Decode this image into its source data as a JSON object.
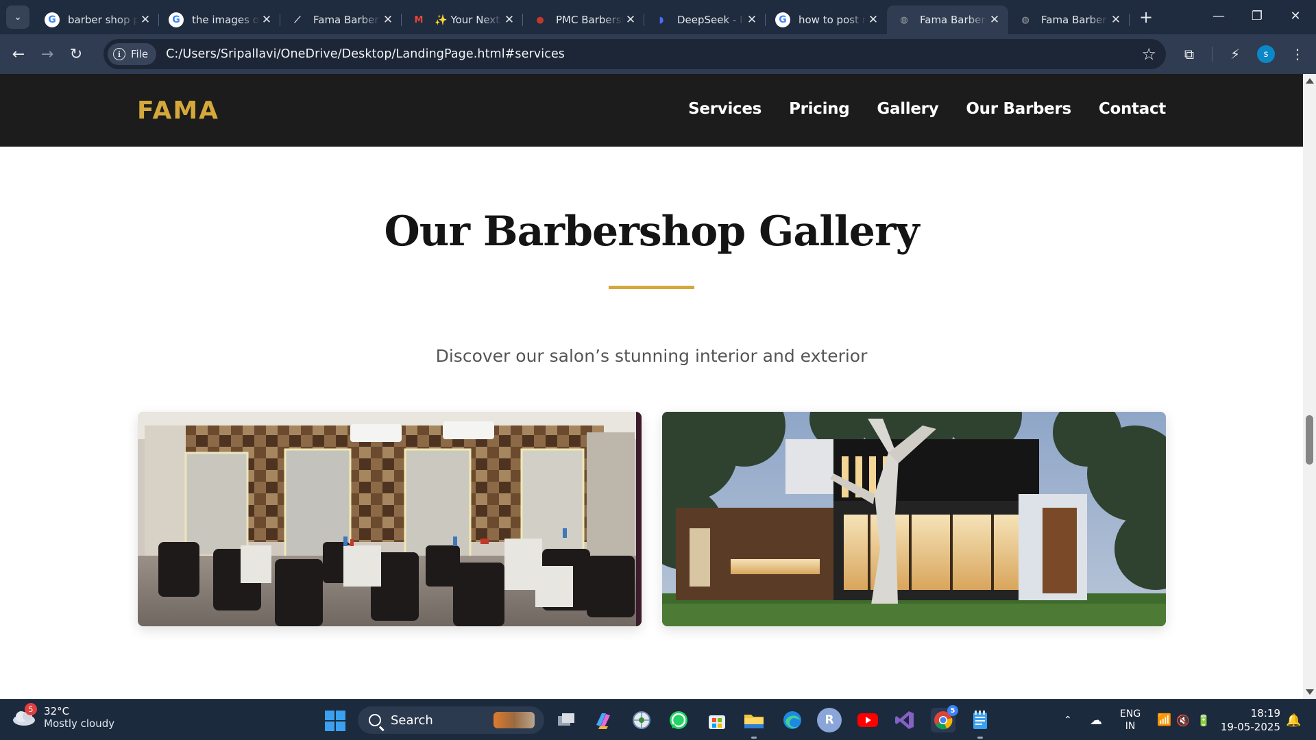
{
  "browser": {
    "tabs": [
      {
        "title": "barber shop p",
        "favicon": "google-icon",
        "color": "#4285f4",
        "active": false
      },
      {
        "title": "the images of",
        "favicon": "google-icon",
        "color": "#4285f4",
        "active": false
      },
      {
        "title": "Fama Barber S",
        "favicon": "tool-icon",
        "color": "#e3e6ea",
        "active": false
      },
      {
        "title": "✨ Your Next",
        "favicon": "gmail-icon",
        "color": "#ea4335",
        "active": false
      },
      {
        "title": "PMC Barbersh",
        "favicon": "pmc-icon",
        "color": "#c0392b",
        "active": false
      },
      {
        "title": "DeepSeek - In",
        "favicon": "deepseek-icon",
        "color": "#4d6bfe",
        "active": false
      },
      {
        "title": "how to post n",
        "favicon": "google-icon",
        "color": "#4285f4",
        "active": false
      },
      {
        "title": "Fama Barber",
        "favicon": "globe-icon",
        "color": "#9aa0a6",
        "active": true
      },
      {
        "title": "Fama Barber",
        "favicon": "globe-icon",
        "color": "#9aa0a6",
        "active": false
      }
    ],
    "chip_label": "File",
    "url": "C:/Users/Sripallavi/OneDrive/Desktop/LandingPage.html#services",
    "profile_initial": "s"
  },
  "site": {
    "logo": "FAMA",
    "nav": [
      "Services",
      "Pricing",
      "Gallery",
      "Our Barbers",
      "Contact"
    ],
    "gallery": {
      "title": "Our Barbershop Gallery",
      "subtitle": "Discover our salon’s stunning interior and exterior"
    },
    "accent": "#d4a83a"
  },
  "taskbar": {
    "weather_badge": "5",
    "temperature": "32°C",
    "condition": "Mostly cloudy",
    "search_label": "Search",
    "app_r_label": "R",
    "chrome_badge": "5",
    "lang_line1": "ENG",
    "lang_line2": "IN",
    "time": "18:19",
    "date": "19-05-2025"
  }
}
